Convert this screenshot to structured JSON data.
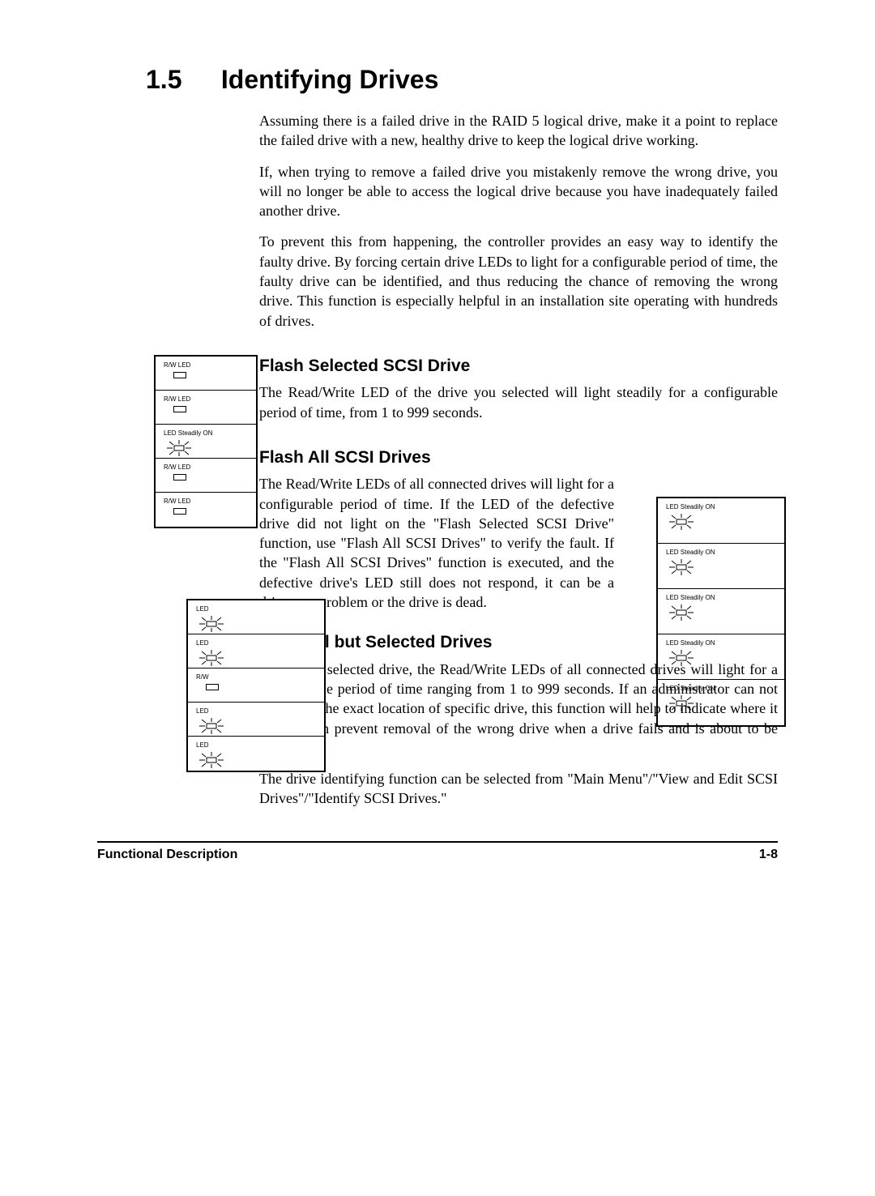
{
  "heading": {
    "number": "1.5",
    "title": "Identifying Drives"
  },
  "paragraphs": {
    "p1": "Assuming there is a failed drive in the RAID 5 logical drive, make it a point to replace the failed drive with a new, healthy drive to keep the logical drive working.",
    "p2": "If, when trying to remove a failed drive you mistakenly remove the wrong drive, you will no longer be able to access the logical drive because you have inadequately failed another drive.",
    "p3": "To prevent this from happening, the controller provides an easy way to identify the faulty drive.  By forcing certain drive LEDs to light for a configurable period of time, the faulty drive can be identified, and thus reducing the chance of removing the wrong drive.  This function is especially helpful in an installation site operating with hundreds of drives."
  },
  "sections": {
    "s1": {
      "title": "Flash Selected SCSI Drive",
      "body": "The Read/Write LED of the drive you selected will light steadily for a configurable period of time, from 1 to 999 seconds."
    },
    "s2": {
      "title": "Flash All SCSI Drives",
      "body": "The Read/Write LEDs of all connected drives will light for a configurable period of time.  If the LED of the defective drive did not light on the \"Flash Selected SCSI Drive\" function, use \"Flash All SCSI Drives\" to verify the fault.  If the \"Flash All SCSI Drives\" function is executed, and the defective drive's LED still does not respond, it can be a drive tray problem or the drive is dead."
    },
    "s3": {
      "title": "Flash All but Selected Drives",
      "body1": "Except the selected drive, the Read/Write LEDs of all connected drives will light for a configurable period of time ranging from 1 to 999 seconds.  If an administrator can not be sure of the exact location of specific drive, this function will help to indicate where it is.  This can prevent removal of the wrong drive when a drive fails and is about to be replaced.",
      "body2": "The drive identifying function can be selected from \"Main Menu\"/\"View and Edit SCSI Drives\"/\"Identify SCSI Drives.\""
    }
  },
  "diagrams": {
    "left": {
      "cells": [
        {
          "label": "R/W LED",
          "mode": "rect"
        },
        {
          "label": "R/W LED",
          "mode": "rect"
        },
        {
          "label": "LED Steadily ON",
          "mode": "rays"
        },
        {
          "label": "R/W LED",
          "mode": "rect"
        },
        {
          "label": "R/W LED",
          "mode": "rect"
        }
      ]
    },
    "right": {
      "cells": [
        {
          "label": "LED Steadily ON",
          "mode": "rays"
        },
        {
          "label": "LED Steadily ON",
          "mode": "rays"
        },
        {
          "label": "LED Steadily ON",
          "mode": "rays"
        },
        {
          "label": "LED Steadily ON",
          "mode": "rays"
        },
        {
          "label": "LED Steadily ON",
          "mode": "rays"
        }
      ]
    },
    "over": {
      "cells": [
        {
          "label": "LED",
          "mode": "rays"
        },
        {
          "label": "LED",
          "mode": "rays"
        },
        {
          "label": "R/W",
          "mode": "rect"
        },
        {
          "label": "LED",
          "mode": "rays"
        },
        {
          "label": "LED",
          "mode": "rays"
        }
      ]
    }
  },
  "footer": {
    "left": "Functional Description",
    "right": "1-8"
  }
}
